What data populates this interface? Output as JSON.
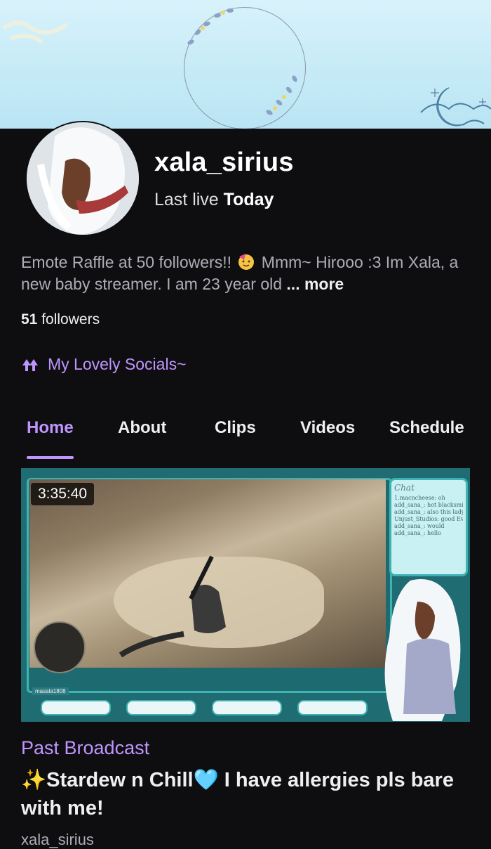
{
  "channel": {
    "username": "xala_sirius",
    "last_live_prefix": "Last live",
    "last_live_value": "Today",
    "bio_part1": "Emote Raffle at 50 followers!!",
    "bio_part2": "Mmm~ Hirooo :3 Im Xala, a new baby streamer. I am 23 year old",
    "bio_more": "... more",
    "followers_count": "51",
    "followers_label": "followers",
    "socials_label": "My Lovely Socials~"
  },
  "tabs": [
    {
      "label": "Home",
      "active": true
    },
    {
      "label": "About"
    },
    {
      "label": "Clips"
    },
    {
      "label": "Videos"
    },
    {
      "label": "Schedule"
    }
  ],
  "video": {
    "duration": "3:35:40",
    "type_label": "Past Broadcast",
    "title": "✨Stardew n Chill🩵 I have allergies pls bare with me!",
    "channel": "xala_sirius",
    "chat_title": "Chat",
    "chat_lines": [
      "1.macncheese: oh",
      "add_sana_: hot blacksmith lady",
      "add_sana_: also this lady",
      "Unjust_Studios: good Evening",
      "add_sana_: would",
      "add_sana_: hello"
    ],
    "stream_label": "masala1808"
  },
  "colors": {
    "accent": "#bf94ff",
    "background": "#0e0e10",
    "banner": "#c6ebf7"
  },
  "icons": {
    "socials": "twitch-glitch-icon",
    "emoji": "partying-face-emoji"
  }
}
